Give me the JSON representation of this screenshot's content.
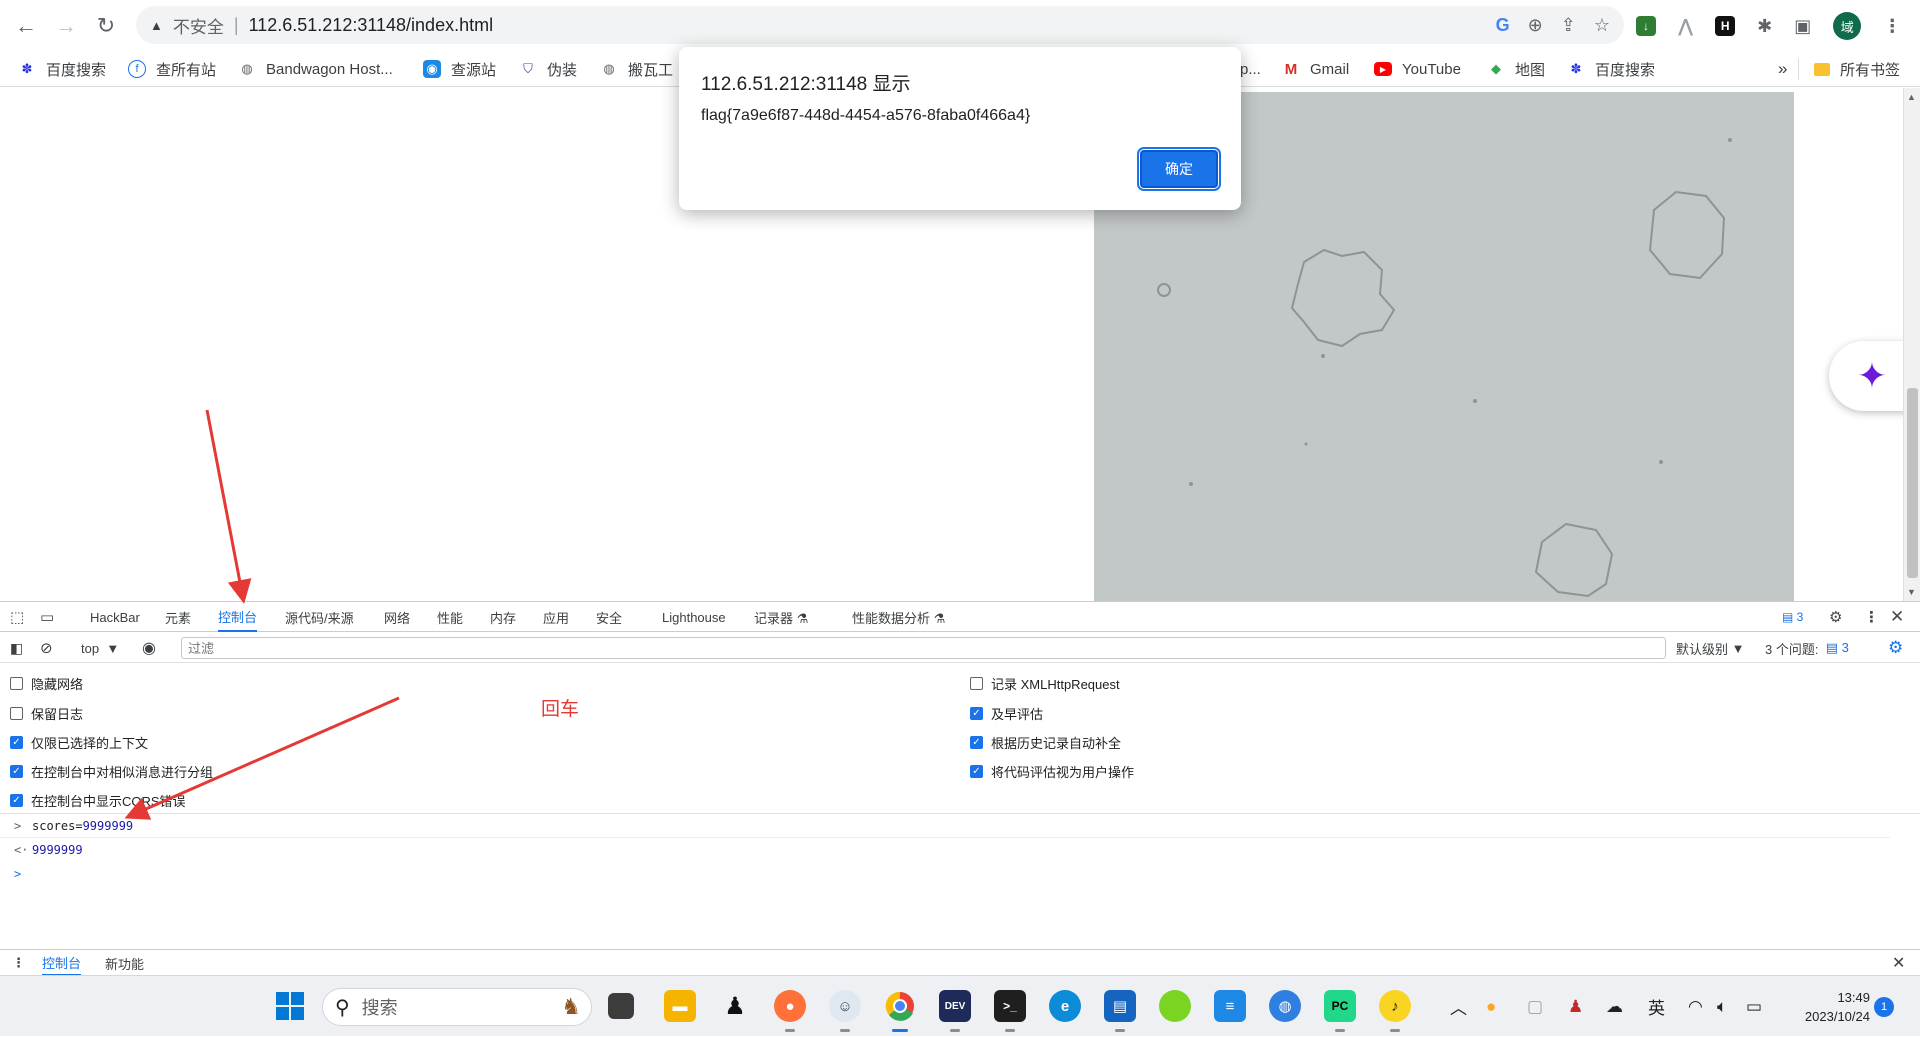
{
  "browser": {
    "security_label": "不安全",
    "url": "112.6.51.212:31148/index.html",
    "profile_initial": "域"
  },
  "bookmarks": {
    "items": [
      {
        "label": "百度搜索",
        "icon": "baidu-paw-icon",
        "color": "#2932e1"
      },
      {
        "label": "查所有站",
        "icon": "globe-f-icon",
        "color": "#1a73e8"
      },
      {
        "label": "Bandwagon Host...",
        "icon": "globe-icon",
        "color": "#5f6368"
      },
      {
        "label": "查源站",
        "icon": "location-pin-icon",
        "color": "#1e88e5"
      },
      {
        "label": "伪装",
        "icon": "shield-icon",
        "color": "#3949ab"
      },
      {
        "label": "搬瓦工",
        "icon": "globe-icon",
        "color": "#5f6368"
      },
      {
        "label": "p...",
        "icon": "",
        "color": "#5f6368"
      },
      {
        "label": "Gmail",
        "icon": "gmail-icon",
        "color": "#d93025"
      },
      {
        "label": "YouTube",
        "icon": "youtube-icon",
        "color": "#ff0000"
      },
      {
        "label": "地图",
        "icon": "maps-icon",
        "color": "#34a853"
      },
      {
        "label": "百度搜索",
        "icon": "baidu-paw-icon",
        "color": "#2932e1"
      }
    ],
    "overflow": "»",
    "all_bookmarks": "所有书签"
  },
  "alert": {
    "title": "112.6.51.212:31148 显示",
    "message": "flag{7a9e6f87-448d-4454-a576-8faba0f466a4}",
    "ok": "确定"
  },
  "devtools": {
    "tabs": [
      "HackBar",
      "元素",
      "控制台",
      "源代码/来源",
      "网络",
      "性能",
      "内存",
      "应用",
      "安全",
      "Lighthouse",
      "记录器 ⚗",
      "性能数据分析 ⚗"
    ],
    "active_tab": "控制台",
    "issues_badge": "3",
    "context": "top",
    "filter_placeholder": "过滤",
    "level": "默认级别",
    "issues_label": "3 个问题:",
    "issues_count": "3",
    "settings_left": [
      {
        "label": "隐藏网络",
        "checked": false
      },
      {
        "label": "保留日志",
        "checked": false
      },
      {
        "label": "仅限已选择的上下文",
        "checked": true
      },
      {
        "label": "在控制台中对相似消息进行分组",
        "checked": true
      },
      {
        "label": "在控制台中显示CORS错误",
        "checked": true
      }
    ],
    "settings_right": [
      {
        "label": "记录 XMLHttpRequest",
        "checked": false
      },
      {
        "label": "及早评估",
        "checked": true
      },
      {
        "label": "根据历史记录自动补全",
        "checked": true
      },
      {
        "label": "将代码评估视为用户操作",
        "checked": true
      }
    ],
    "console": {
      "input_prefix": ">",
      "input_code": "scores=",
      "input_value": "9999999",
      "output_prefix": "<·",
      "output_value": "9999999",
      "prompt": ">"
    },
    "drawer_tabs": [
      "控制台",
      "新功能"
    ]
  },
  "annotation": {
    "text": "回车",
    "color": "#e53935"
  },
  "taskbar": {
    "search_label": "搜索",
    "ime": "英",
    "time": "13:49",
    "date": "2023/10/24",
    "notifications": "1"
  }
}
